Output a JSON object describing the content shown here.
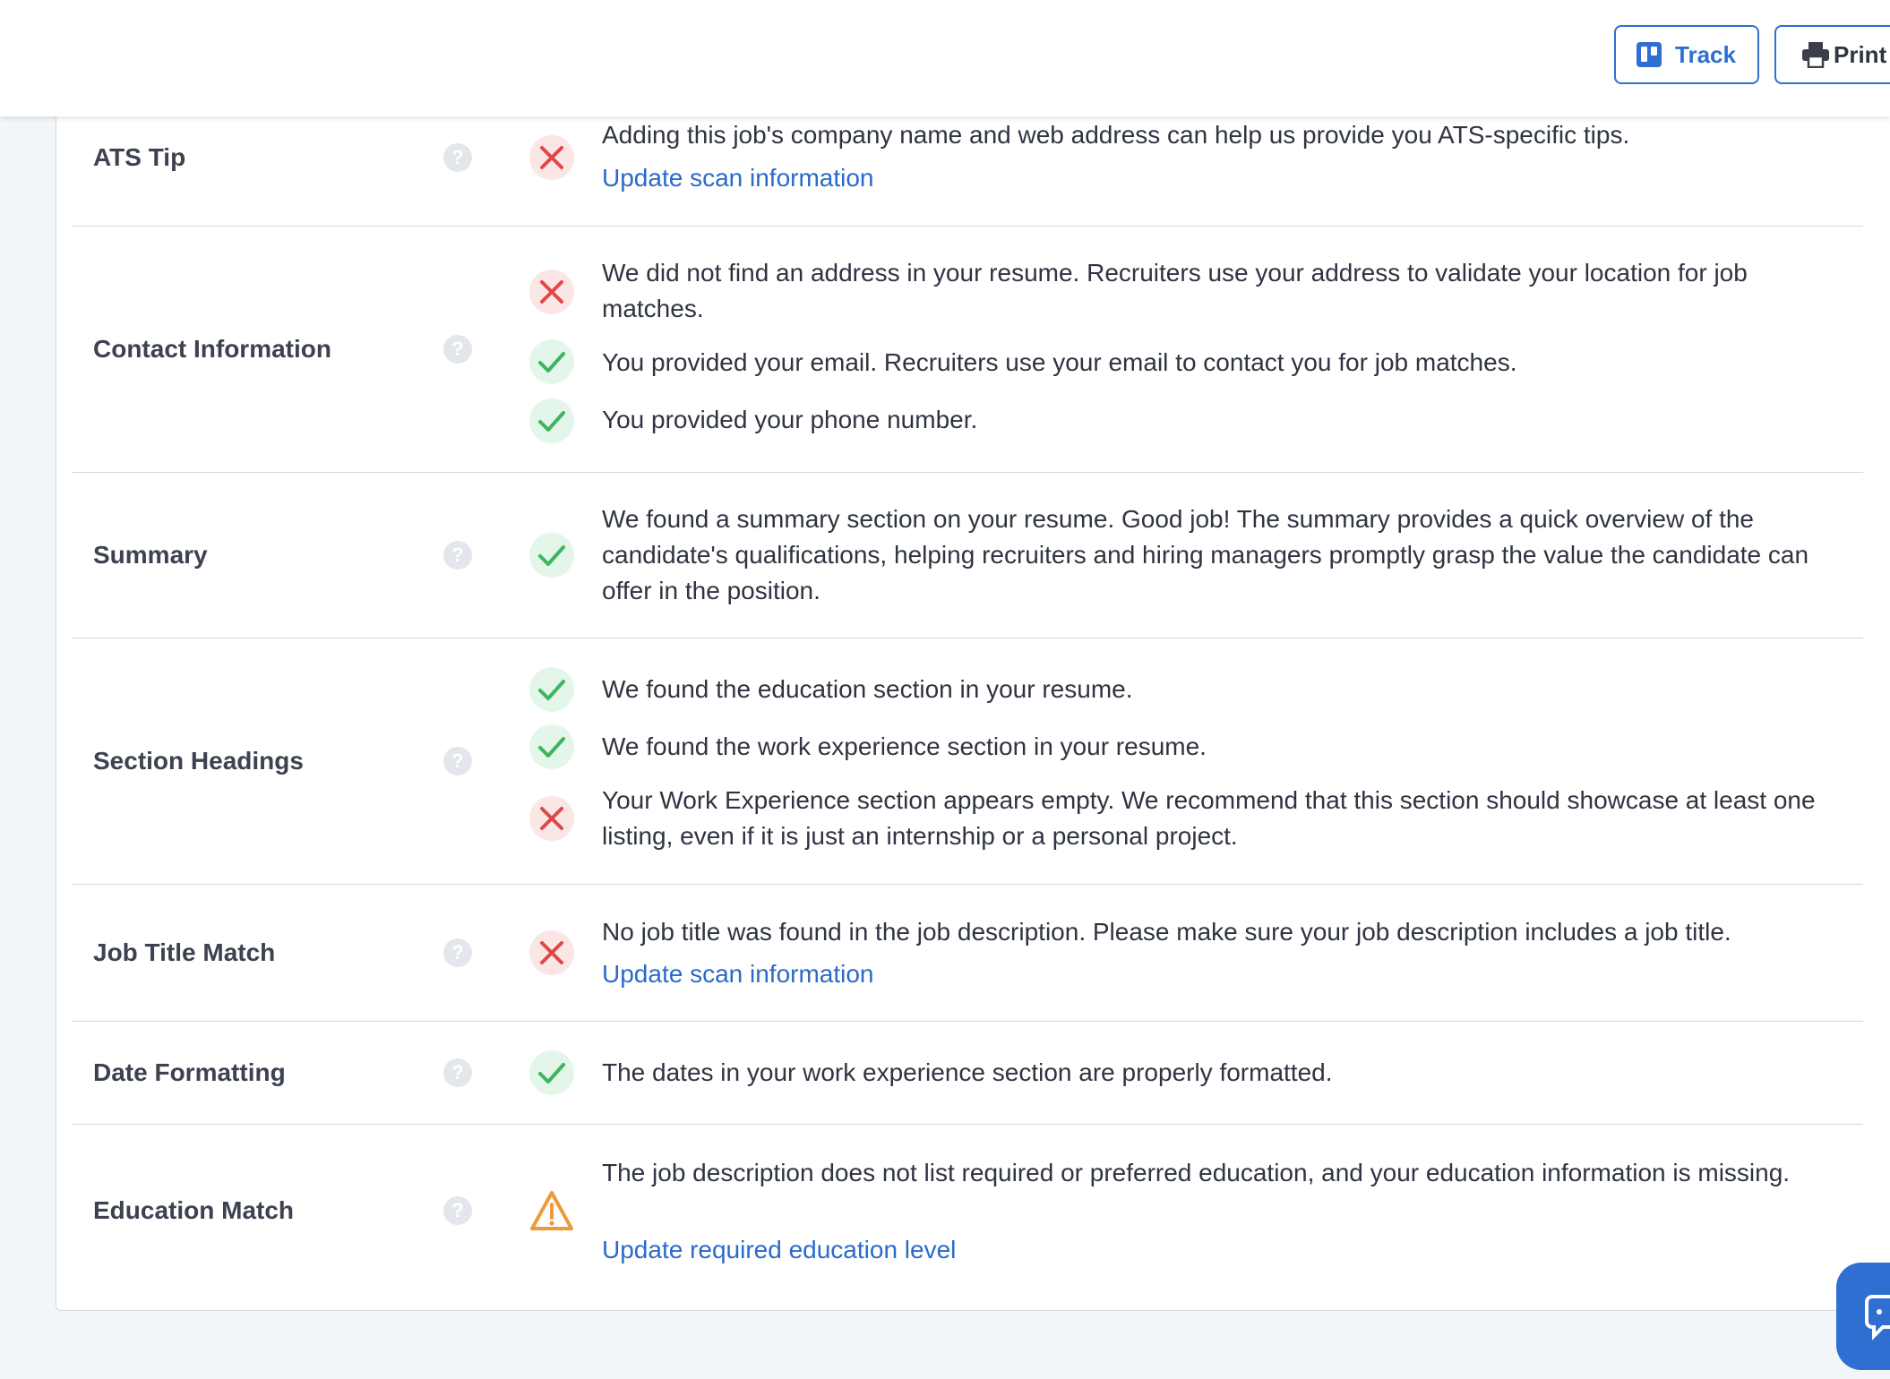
{
  "toolbar": {
    "track_label": "Track",
    "print_label": "Print"
  },
  "rows": [
    {
      "label": "ATS Tip",
      "items": [
        {
          "status": "fail",
          "text": "Adding this job's company name and web address can help us provide you ATS-specific tips.",
          "link": "Update scan information"
        }
      ]
    },
    {
      "label": "Contact Information",
      "items": [
        {
          "status": "fail",
          "text": "We did not find an address in your resume. Recruiters use your address to validate your location for job matches."
        },
        {
          "status": "pass",
          "text": "You provided your email. Recruiters use your email to contact you for job matches."
        },
        {
          "status": "pass",
          "text": "You provided your phone number."
        }
      ]
    },
    {
      "label": "Summary",
      "items": [
        {
          "status": "pass",
          "text": "We found a summary section on your resume. Good job! The summary provides a quick overview of the candidate's qualifications, helping recruiters and hiring managers promptly grasp the value the candidate can offer in the position."
        }
      ]
    },
    {
      "label": "Section Headings",
      "items": [
        {
          "status": "pass",
          "text": "We found the education section in your resume."
        },
        {
          "status": "pass",
          "text": "We found the work experience section in your resume."
        },
        {
          "status": "fail",
          "text": "Your Work Experience section appears empty. We recommend that this section should showcase at least one listing, even if it is just an internship or a personal project."
        }
      ]
    },
    {
      "label": "Job Title Match",
      "items": [
        {
          "status": "fail",
          "text": "No job title was found in the job description. Please make sure your job description includes a job title.",
          "link": "Update scan information"
        }
      ]
    },
    {
      "label": "Date Formatting",
      "items": [
        {
          "status": "pass",
          "text": "The dates in your work experience section are properly formatted."
        }
      ]
    },
    {
      "label": "Education Match",
      "items": [
        {
          "status": "warn",
          "text": "The job description does not list required or preferred education, and your education information is missing.",
          "link": "Update required education level"
        }
      ]
    }
  ],
  "help_glyph": "?",
  "colors": {
    "accent": "#2e6fd1",
    "link": "#2a6ac9",
    "pass": "#3fb45f",
    "fail": "#e04848",
    "warn": "#ef9a3a"
  }
}
